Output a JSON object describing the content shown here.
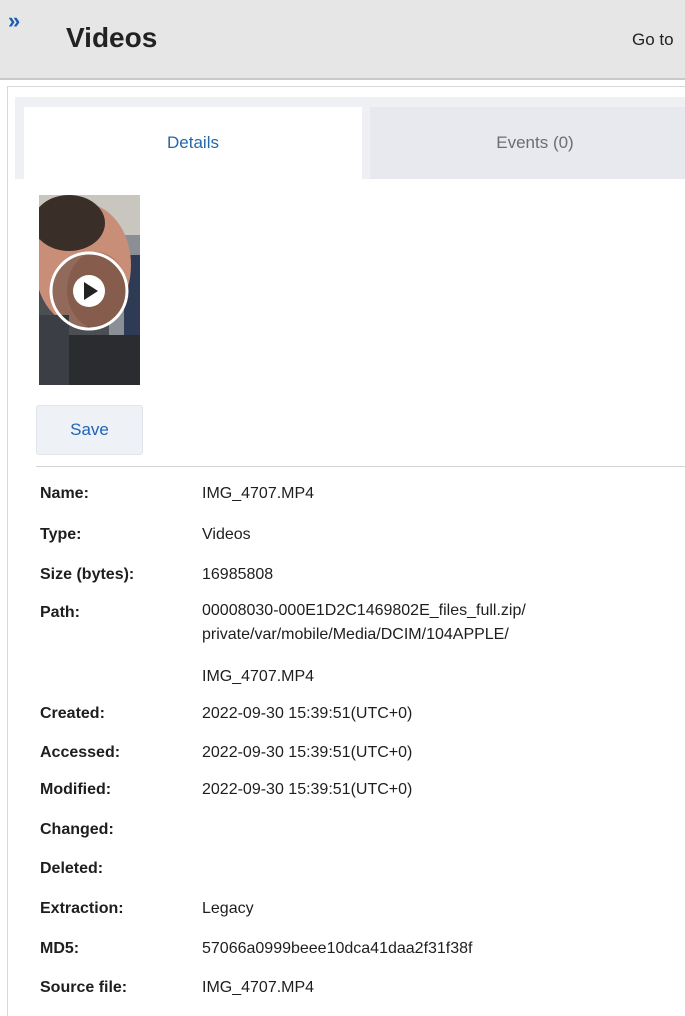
{
  "header": {
    "expand_icon": "double-chevron-right-icon",
    "expand_glyph": "»",
    "title": "Videos",
    "goto_label": "Go to"
  },
  "tabs": [
    {
      "label": "Details",
      "active": true
    },
    {
      "label": "Events (0)",
      "active": false
    }
  ],
  "media": {
    "play_icon": "play-icon"
  },
  "save_label": "Save",
  "fields": [
    {
      "label": "Name:",
      "value": "IMG_4707.MP4"
    },
    {
      "label": "Type:",
      "value": "Videos"
    },
    {
      "label": "Size (bytes):",
      "value": "16985808"
    },
    {
      "label": "Path:",
      "lines": [
        "00008030-000E1D2C1469802E_files_full.zip/",
        "private/var/mobile/Media/DCIM/104APPLE/",
        "IMG_4707.MP4"
      ]
    },
    {
      "label": "Created:",
      "value": "2022-09-30 15:39:51(UTC+0)"
    },
    {
      "label": "Accessed:",
      "value": "2022-09-30 15:39:51(UTC+0)"
    },
    {
      "label": "Modified:",
      "value": "2022-09-30 15:39:51(UTC+0)"
    },
    {
      "label": "Changed:",
      "value": ""
    },
    {
      "label": "Deleted:",
      "value": ""
    },
    {
      "label": "Extraction:",
      "value": "Legacy"
    },
    {
      "label": "MD5:",
      "value": "57066a0999beee10dca41daa2f31f38f"
    },
    {
      "label": "Source file:",
      "value": "IMG_4707.MP4"
    }
  ]
}
